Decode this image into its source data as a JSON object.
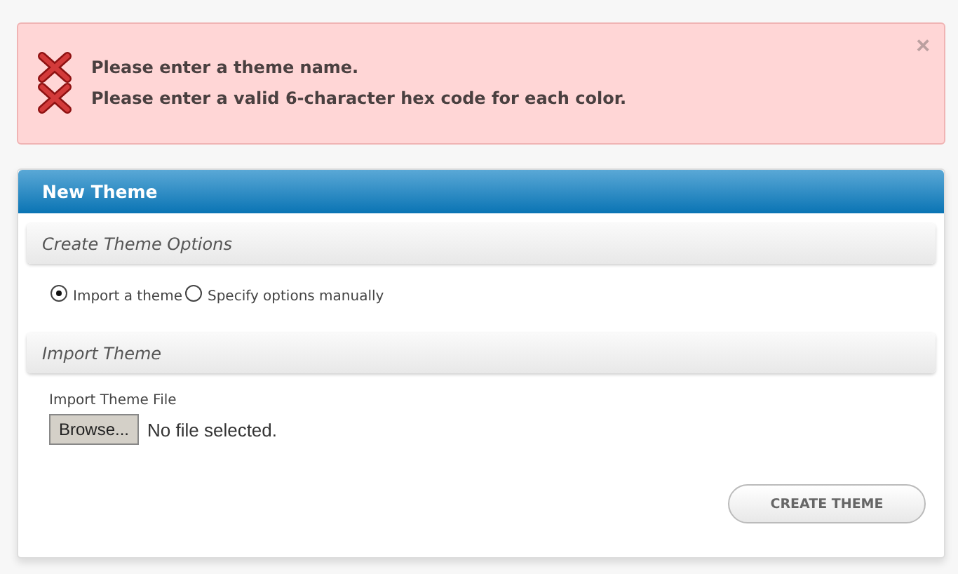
{
  "alert": {
    "close": "×",
    "errors": [
      "Please enter a theme name.",
      "Please enter a valid 6-character hex code for each color."
    ]
  },
  "panel": {
    "title": "New Theme",
    "sections": [
      {
        "title": "Create Theme Options",
        "kind": "radios",
        "options": [
          {
            "label": "Import a theme",
            "selected": true
          },
          {
            "label": "Specify options manually",
            "selected": false
          }
        ]
      },
      {
        "title": "Import Theme",
        "kind": "file",
        "label": "Import Theme File",
        "button": "Browse...",
        "status": "No file selected."
      }
    ],
    "submit": "CREATE THEME"
  }
}
